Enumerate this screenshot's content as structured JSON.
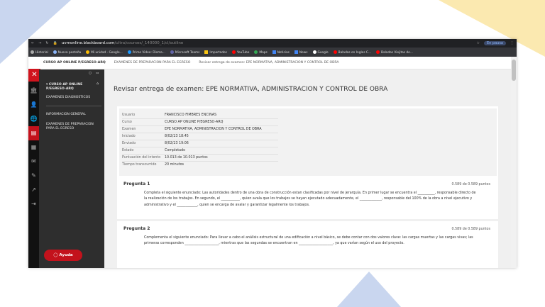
{
  "browser": {
    "url_host": "uvmonline.blackboard.com",
    "url_path": "/ultra/courses/_140000_1/cl/outline",
    "profile": "En pausa",
    "bookmarks": [
      "Historial",
      "Nueva pestaña",
      "Mi unidad - Google...",
      "Prime Video: Disma...",
      "Microsoft Teams",
      "Importados",
      "YouTube",
      "Maps",
      "Noticias",
      "News",
      "Google",
      "Baladas en Ingles C...",
      "Baladas Viejitas de..."
    ]
  },
  "breadcrumb": [
    "CURSO AP ONLINE P/EGRESO-ARQ",
    "EXAMENES DE PREPARACION PARA EL EGRESO",
    "Revisar entrega de examen: EPE NORMATIVA, ADMINISTRACION Y CONTROL DE OBRA"
  ],
  "sidebar": {
    "course": "CURSO AP ONLINE P/EGRESO-ARQ",
    "items": [
      "EXAMENES DIAGNOSTICOS",
      "INFORMACION GENERAL",
      "EXAMENES DE PREPARACION PARA EL EGRESO"
    ],
    "help": "Ayuda"
  },
  "page": {
    "title": "Revisar entrega de examen: EPE NORMATIVA, ADMINISTRACION Y CONTROL DE OBRA"
  },
  "info": [
    {
      "k": "Usuario",
      "v": "FRANCISCO FIMBRES ENCINAS"
    },
    {
      "k": "Curso",
      "v": "CURSO AP ONLINE P/EGRESO-ARQ"
    },
    {
      "k": "Examen",
      "v": "EPE NORMATIVA, ADMINISTRACION Y CONTROL DE OBRA"
    },
    {
      "k": "Iniciado",
      "v": "8/02/23 18:45"
    },
    {
      "k": "Enviado",
      "v": "8/02/23 19:06"
    },
    {
      "k": "Estado",
      "v": "Completado"
    },
    {
      "k": "Puntuación del intento",
      "v": "10.013 de 10.013 puntos"
    },
    {
      "k": "Tiempo transcurrido",
      "v": "20 minutos"
    }
  ],
  "questions": [
    {
      "title": "Pregunta 1",
      "points": "0.589 de 0.589 puntos",
      "text": "Completa el siguiente enunciado: Las autoridades dentro de una obra de construcción estan clasificadas por nivel de jerarquía. En primer lugar se encuentra el __________, responsable directo de la realización de los trabajos. En segundo, el ___________, quien avala que los trabajos se hayan ejecutado adecuadamente, el _____________, responsable del 100% de la obra a nivel ejecutivo y administrativo y el ____________, quien se encarga de avalar y garantizar legalmente los trabajos."
    },
    {
      "title": "Pregunta 2",
      "points": "0.589 de 0.589 puntos",
      "text": "Complementa el siguiente enunciado: Para llevar a cabo el análisis estructural de una edificación a nivel básico, se debe contar con dos valores clave: las cargas muertas y las cargas vivas; las primeras corresponden ____________________, mientras que las segundas se encuentran en ____________________, ya que varían según el uso del proyecto."
    }
  ]
}
